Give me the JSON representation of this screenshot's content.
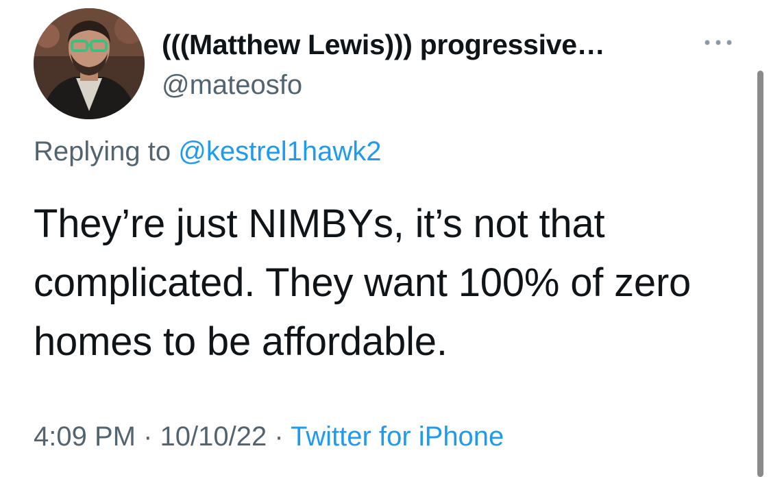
{
  "user": {
    "display_name": "(((Matthew Lewis))) progressive…",
    "handle": "@mateosfo",
    "avatar_icon": "profile-photo"
  },
  "reply": {
    "prefix": "Replying to ",
    "mention": "@kestrel1hawk2"
  },
  "tweet": {
    "text": "They’re just NIMBYs, it’s not that complicated. They want 100% of zero homes to be affordable."
  },
  "meta": {
    "time": "4:09 PM",
    "sep1": " · ",
    "date": "10/10/22",
    "sep2": " · ",
    "source": "Twitter for iPhone"
  },
  "colors": {
    "text": "#0f1419",
    "secondary": "#536471",
    "link": "#1d9bf0"
  },
  "icons": {
    "more": "more-dots-icon"
  }
}
